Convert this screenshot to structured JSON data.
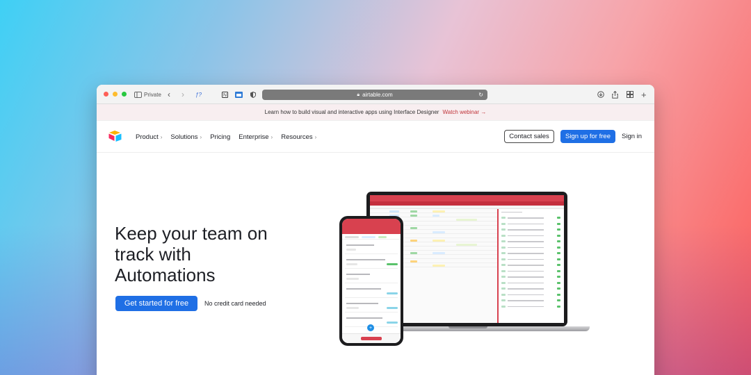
{
  "browser": {
    "mode_label": "Private",
    "url": "airtable.com",
    "traffic_lights": [
      "#fe5f57",
      "#febc2e",
      "#28c840"
    ]
  },
  "banner": {
    "text": "Learn how to build visual and interactive apps using Interface Designer",
    "link": "Watch webinar →"
  },
  "nav": {
    "items": [
      {
        "label": "Product",
        "has_menu": true
      },
      {
        "label": "Solutions",
        "has_menu": true
      },
      {
        "label": "Pricing",
        "has_menu": false
      },
      {
        "label": "Enterprise",
        "has_menu": true
      },
      {
        "label": "Resources",
        "has_menu": true
      }
    ],
    "contact_label": "Contact sales",
    "signup_label": "Sign up for free",
    "signin_label": "Sign in"
  },
  "hero": {
    "title_lines": [
      "Keep your team on",
      "track with",
      "Automations"
    ],
    "cta_label": "Get started for free",
    "note": "No credit card needed"
  },
  "colors": {
    "accent": "#1f6fe5",
    "app_header": "#d8414f",
    "banner_link": "#c0343a"
  }
}
